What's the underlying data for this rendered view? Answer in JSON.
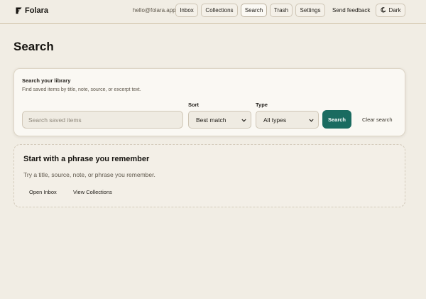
{
  "brand": {
    "name": "Folara",
    "icon": "folara-logo-icon"
  },
  "header": {
    "email": "hello@folara.app",
    "nav": {
      "inbox": "Inbox",
      "collections": "Collections",
      "search": "Search",
      "trash": "Trash",
      "settings": "Settings"
    },
    "feedback": "Send feedback",
    "theme_toggle": {
      "label": "Dark",
      "icon": "moon-icon"
    }
  },
  "page": {
    "title": "Search"
  },
  "search_card": {
    "heading": "Search your library",
    "subheading": "Find saved items by title, note, source, or excerpt text.",
    "input": {
      "placeholder": "Search saved items",
      "value": ""
    },
    "sort": {
      "label": "Sort",
      "selected": "Best match"
    },
    "type": {
      "label": "Type",
      "selected": "All types"
    },
    "search_button": "Search",
    "clear_link": "Clear search"
  },
  "empty_state": {
    "title": "Start with a phrase you remember",
    "text": "Try a title, source, note, or phrase you remember.",
    "actions": {
      "open_inbox": "Open Inbox",
      "view_collections": "View Collections"
    }
  },
  "colors": {
    "background": "#f1ede4",
    "accent": "#1a6b60",
    "card": "#faf8f3",
    "border": "#cdbfa3"
  }
}
